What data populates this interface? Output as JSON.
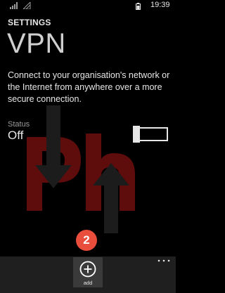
{
  "status_bar": {
    "time": "19:39",
    "icons": [
      "signal-icon",
      "wifi-icon",
      "battery-icon"
    ]
  },
  "header": {
    "section": "SETTINGS",
    "title": "VPN"
  },
  "description": "Connect to your organisation's network or the Internet from anywhere over a more secure connection.",
  "status": {
    "label": "Status",
    "value": "Off",
    "toggle_on": false
  },
  "app_bar": {
    "add_label": "add",
    "add_icon": "plus-circle-icon",
    "more_icon": "more-dots-icon"
  },
  "annotation": {
    "step": "2",
    "color": "#e94e3d"
  },
  "colors": {
    "background": "#000000",
    "app_bar": "#1f1f1f",
    "watermark": "#7a1010"
  }
}
